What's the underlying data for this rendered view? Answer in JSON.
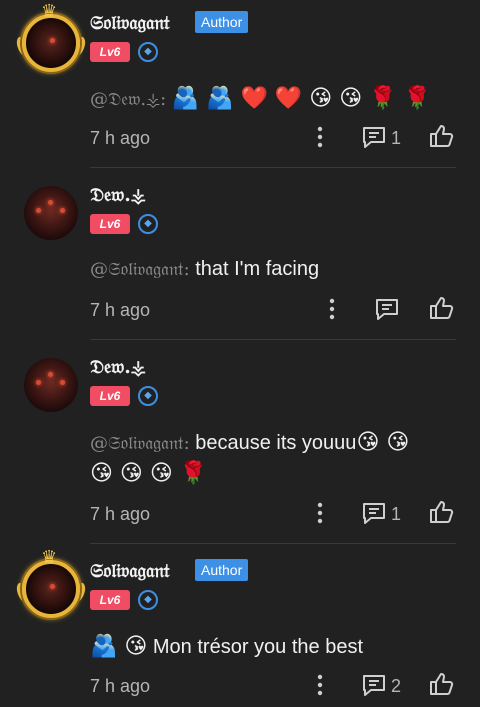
{
  "comments": [
    {
      "username": "𝔖𝔬𝔩𝔦𝔳𝔞𝔤𝔞𝔫𝔱",
      "author_badge": "Author",
      "level": "Lv6",
      "mention": "@𝔇𝔢𝔴.⚶:",
      "text": "",
      "emojis": "🫂 🫂 ❤️ ❤️ 😘 😘 🌹 🌹",
      "time": "7 h ago",
      "reply_count": "1"
    },
    {
      "username": "𝔇𝔢𝔴.⚶",
      "level": "Lv6",
      "mention": "@𝔖𝔬𝔩𝔦𝔳𝔞𝔤𝔞𝔫𝔱:",
      "text": "that I'm facing",
      "time": "7 h ago",
      "reply_count": ""
    },
    {
      "username": "𝔇𝔢𝔴.⚶",
      "level": "Lv6",
      "mention": "@𝔖𝔬𝔩𝔦𝔳𝔞𝔤𝔞𝔫𝔱:",
      "text": "because its youuu",
      "emojis_inline": "😘 😘",
      "emojis_line2": "😘 😘 😘 🌹",
      "time": "7 h ago",
      "reply_count": "1"
    },
    {
      "username": "𝔖𝔬𝔩𝔦𝔳𝔞𝔤𝔞𝔫𝔱",
      "author_badge": "Author",
      "level": "Lv6",
      "emojis": "🫂 😘",
      "text": "Mon trésor you the best",
      "time": "7 h ago",
      "reply_count": "2"
    }
  ],
  "icons": {
    "more": "more-vertical-icon",
    "reply": "comment-icon",
    "like": "thumbs-up-icon",
    "badge": "shield-icon"
  },
  "colors": {
    "background": "#212121",
    "author_badge": "#3c91e6",
    "level_badge": "#f04c63",
    "muted_text": "#b5b5b5"
  }
}
